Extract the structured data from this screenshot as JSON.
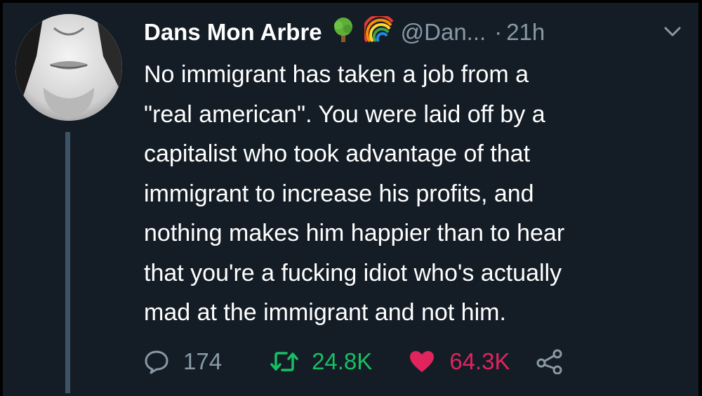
{
  "tweet": {
    "display_name": "Dans Mon Arbre",
    "emoji": [
      "tree-emoji",
      "rainbow-emoji"
    ],
    "handle": "@Dan...",
    "separator": "·",
    "time": "21h",
    "text_lines": [
      "No immigrant has taken a job from a",
      "\"real american\".  You were laid off by a",
      "capitalist who took advantage of that",
      "immigrant to increase his profits, and",
      "nothing makes him happier than to hear",
      "that you're a fucking idiot who's actually",
      "mad at the immigrant and not him."
    ]
  },
  "actions": {
    "replies": "174",
    "retweets": "24.8K",
    "likes": "64.3K"
  },
  "colors": {
    "background": "#141d26",
    "muted": "#8899a6",
    "retweet": "#17bf63",
    "like": "#e0245e",
    "thread_line": "#3d5466"
  },
  "icons": {
    "reply": "reply-icon",
    "retweet": "retweet-icon",
    "like": "heart-icon",
    "share": "share-icon",
    "menu": "chevron-down-icon"
  }
}
